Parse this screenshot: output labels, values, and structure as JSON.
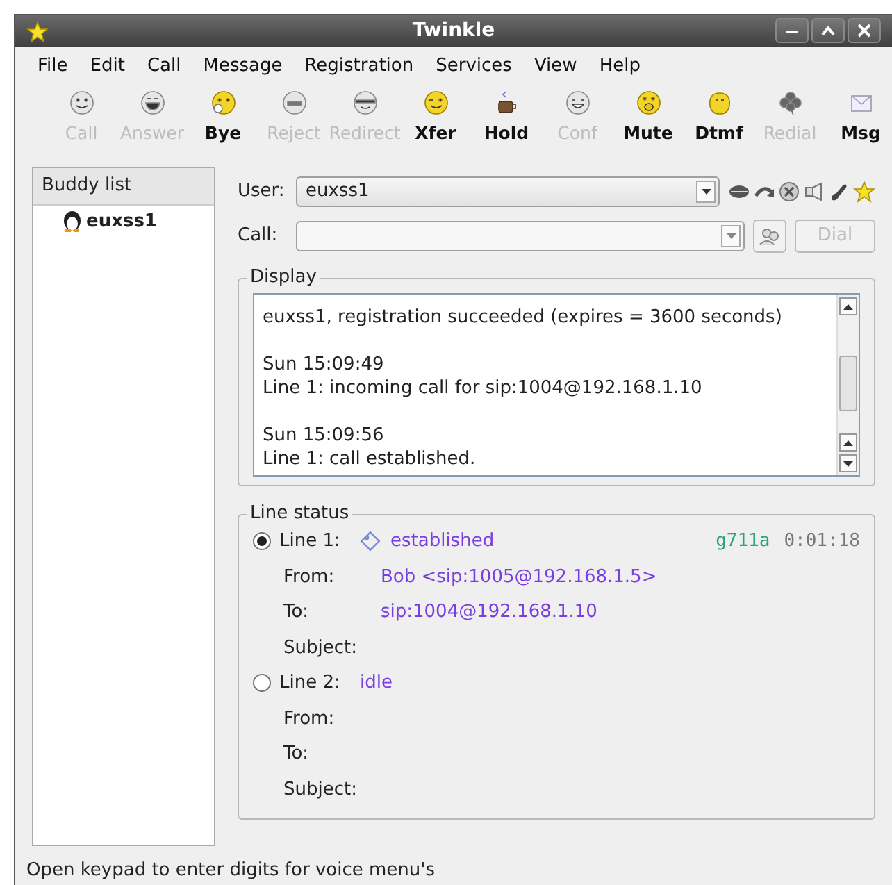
{
  "window": {
    "title": "Twinkle"
  },
  "menu": [
    {
      "label": "File"
    },
    {
      "label": "Edit"
    },
    {
      "label": "Call"
    },
    {
      "label": "Message"
    },
    {
      "label": "Registration"
    },
    {
      "label": "Services"
    },
    {
      "label": "View"
    },
    {
      "label": "Help"
    }
  ],
  "toolbar": [
    {
      "label": "Call",
      "disabled": true
    },
    {
      "label": "Answer",
      "disabled": true
    },
    {
      "label": "Bye",
      "disabled": false
    },
    {
      "label": "Reject",
      "disabled": true
    },
    {
      "label": "Redirect",
      "disabled": true
    },
    {
      "label": "Xfer",
      "disabled": false
    },
    {
      "label": "Hold",
      "disabled": false
    },
    {
      "label": "Conf",
      "disabled": true
    },
    {
      "label": "Mute",
      "disabled": false
    },
    {
      "label": "Dtmf",
      "disabled": false
    },
    {
      "label": "Redial",
      "disabled": true
    },
    {
      "label": "Msg",
      "disabled": false
    }
  ],
  "buddy_list": {
    "title": "Buddy list",
    "items": [
      {
        "name": "euxss1"
      }
    ]
  },
  "user": {
    "label": "User:",
    "value": "euxss1"
  },
  "call": {
    "label": "Call:"
  },
  "dial_button": {
    "label": "Dial",
    "disabled": true
  },
  "display": {
    "title": "Display",
    "messages": [
      {
        "text": "euxss1, registration succeeded (expires = 3600 seconds)"
      },
      {
        "time": "Sun 15:09:49",
        "text": "Line 1: incoming call for sip:1004@192.168.1.10"
      },
      {
        "time": "Sun 15:09:56",
        "text": "Line 1: call established."
      }
    ]
  },
  "line_status": {
    "title": "Line status",
    "lines": [
      {
        "label": "Line 1:",
        "selected": true,
        "state": "established",
        "codec": "g711a",
        "duration": "0:01:18",
        "fields": [
          {
            "label": "From:",
            "value": "Bob <sip:1005@192.168.1.5>"
          },
          {
            "label": "To:",
            "value": "sip:1004@192.168.1.10"
          },
          {
            "label": "Subject:"
          }
        ]
      },
      {
        "label": "Line 2:",
        "selected": false,
        "state": "idle",
        "fields": [
          {
            "label": "From:"
          },
          {
            "label": "To:"
          },
          {
            "label": "Subject:"
          }
        ]
      }
    ]
  },
  "status_bar": "Open keypad to enter digits for voice menu's"
}
